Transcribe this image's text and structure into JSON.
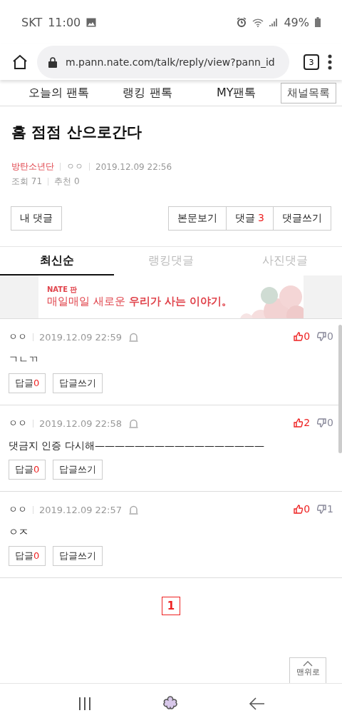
{
  "status_bar": {
    "carrier": "SKT",
    "time": "11:00",
    "battery": "49%"
  },
  "browser": {
    "url": "m.pann.nate.com/talk/reply/view?pann_id",
    "tab_count": "3"
  },
  "nav": [
    {
      "label": "오늘의 팬톡",
      "kind": "link"
    },
    {
      "label": "랭킹 팬톡",
      "kind": "link"
    },
    {
      "label": "MY팬톡",
      "kind": "link"
    },
    {
      "label": "채널목록",
      "kind": "button"
    }
  ],
  "post": {
    "title": "흠 점점 산으로간다",
    "channel": "방탄소년단",
    "author": "ㅇㅇ",
    "date": "2019.12.09 22:56",
    "views": "조회 71",
    "recommends": "추천 0"
  },
  "actions": {
    "my_comments": "내 댓글",
    "buttons": [
      {
        "label": "본문보기"
      },
      {
        "label": "댓글",
        "count": "3"
      },
      {
        "label": "댓글쓰기"
      }
    ]
  },
  "tabs": [
    {
      "label": "최신순",
      "selected": true
    },
    {
      "label": "랭킹댓글",
      "selected": false
    },
    {
      "label": "사진댓글",
      "selected": false
    }
  ],
  "banner": {
    "logo": "NATE 판",
    "text": "매일매일 새로운 **우리가 사는 이야기。**"
  },
  "comments": [
    {
      "author": "ㅇㅇ",
      "date": "2019.12.09 22:59",
      "body": "ㄱㄴㄲ",
      "likes": "0",
      "dislikes": "0",
      "reply_label": "답글",
      "reply_count": "0",
      "write_reply": "답글쓰기"
    },
    {
      "author": "ㅇㅇ",
      "date": "2019.12.09 22:58",
      "body": "댓금지 인증 다시해—————————————————",
      "likes": "2",
      "dislikes": "0",
      "reply_label": "답글",
      "reply_count": "0",
      "write_reply": "답글쓰기"
    },
    {
      "author": "ㅇㅇ",
      "date": "2019.12.09 22:57",
      "body": "ㅇㅈ",
      "likes": "0",
      "dislikes": "1",
      "reply_label": "답글",
      "reply_count": "0",
      "write_reply": "답글쓰기"
    }
  ],
  "pagination": [
    {
      "label": "1",
      "selected": true
    }
  ],
  "top_button": "맨위로"
}
